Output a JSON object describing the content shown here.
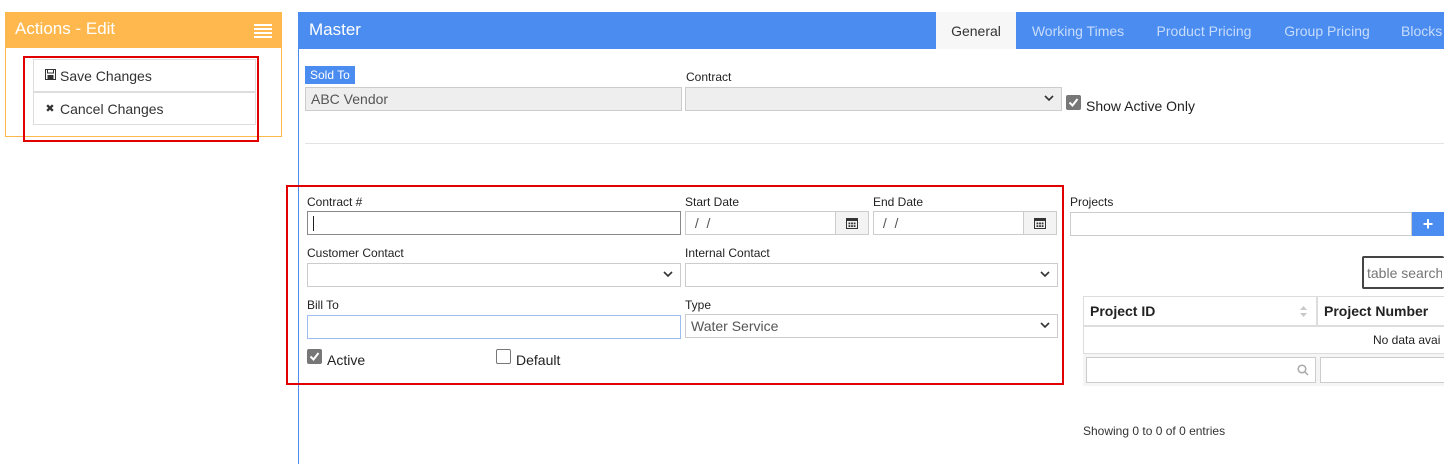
{
  "actions": {
    "title": "Actions - Edit",
    "save_label": "Save Changes",
    "cancel_label": "Cancel Changes"
  },
  "master": {
    "title": "Master",
    "tabs": [
      {
        "label": "General",
        "active": true
      },
      {
        "label": "Working Times",
        "active": false
      },
      {
        "label": "Product Pricing",
        "active": false
      },
      {
        "label": "Group Pricing",
        "active": false
      },
      {
        "label": "Blocks",
        "active": false
      }
    ]
  },
  "top_form": {
    "sold_to_label": "Sold To",
    "sold_to_value": "ABC Vendor",
    "contract_label": "Contract",
    "contract_value": "",
    "show_active_only_label": "Show Active Only",
    "show_active_only_checked": true
  },
  "contract_form": {
    "contract_no_label": "Contract #",
    "contract_no_value": "",
    "start_date_label": "Start Date",
    "start_date_value": " /  /",
    "end_date_label": "End Date",
    "end_date_value": " /  /",
    "customer_contact_label": "Customer Contact",
    "customer_contact_value": "",
    "internal_contact_label": "Internal Contact",
    "internal_contact_value": "",
    "bill_to_label": "Bill To",
    "bill_to_value": "",
    "type_label": "Type",
    "type_value": "Water Service",
    "active_label": "Active",
    "active_checked": true,
    "default_label": "Default",
    "default_checked": false
  },
  "projects": {
    "label": "Projects",
    "add_symbol": "+",
    "search_placeholder": "table search",
    "columns": [
      "Project ID",
      "Project Number"
    ],
    "empty_message": "No data avai",
    "footer": "Showing 0 to 0 of 0 entries"
  },
  "colors": {
    "accent_orange": "#ffb84d",
    "primary_blue": "#4a8cf0",
    "highlight_red": "#e00000"
  }
}
